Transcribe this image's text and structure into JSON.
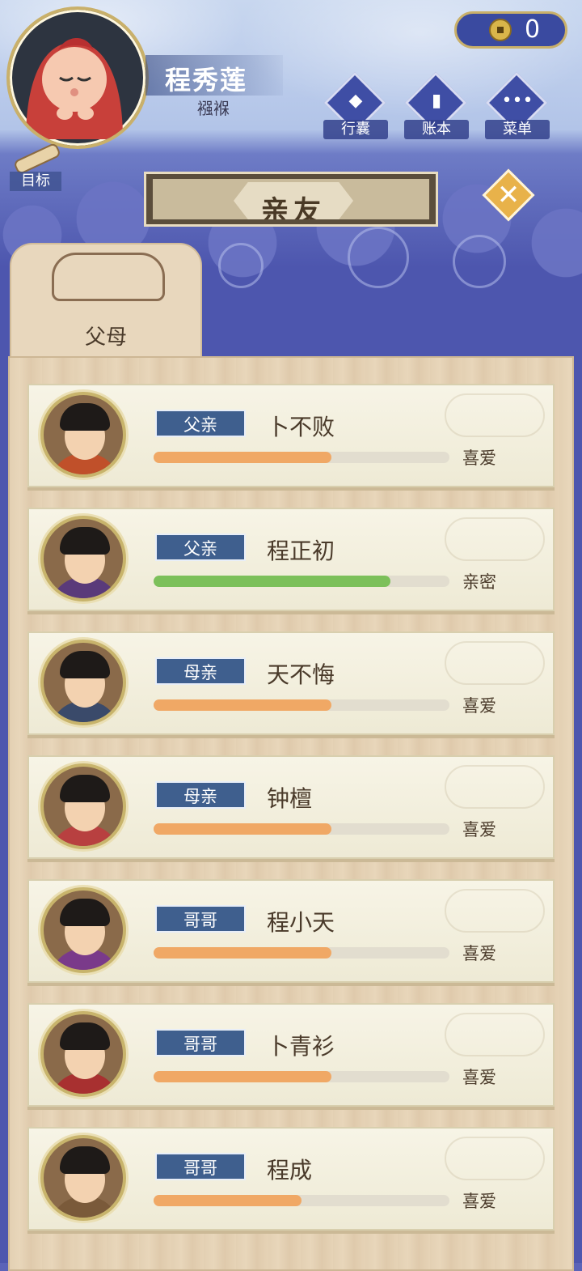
{
  "player": {
    "name": "程秀莲",
    "age_stage": "襁褓"
  },
  "goal": {
    "label": "目标"
  },
  "currency": {
    "amount": "0",
    "icon": "copper-coin-icon"
  },
  "top_buttons": [
    {
      "id": "bag",
      "label": "行囊",
      "icon": "bag-icon"
    },
    {
      "id": "ledger",
      "label": "账本",
      "icon": "ledger-icon"
    },
    {
      "id": "menu",
      "label": "菜单",
      "icon": "more-icon"
    }
  ],
  "title": "亲友",
  "tabs": [
    {
      "label": "父母",
      "active": true
    }
  ],
  "relatives": [
    {
      "relation": "父亲",
      "name": "卜不败",
      "status": "喜爱",
      "affinity": 0.6,
      "bar_color": "#f0a865",
      "robe_color": "#c0502a"
    },
    {
      "relation": "父亲",
      "name": "程正初",
      "status": "亲密",
      "affinity": 0.8,
      "bar_color": "#7cc05a",
      "robe_color": "#5a3a7a"
    },
    {
      "relation": "母亲",
      "name": "天不悔",
      "status": "喜爱",
      "affinity": 0.6,
      "bar_color": "#f0a865",
      "robe_color": "#3a4a6a"
    },
    {
      "relation": "母亲",
      "name": "钟檀",
      "status": "喜爱",
      "affinity": 0.6,
      "bar_color": "#f0a865",
      "robe_color": "#b84040"
    },
    {
      "relation": "哥哥",
      "name": "程小天",
      "status": "喜爱",
      "affinity": 0.6,
      "bar_color": "#f0a865",
      "robe_color": "#7a3a8a"
    },
    {
      "relation": "哥哥",
      "name": "卜青衫",
      "status": "喜爱",
      "affinity": 0.6,
      "bar_color": "#f0a865",
      "robe_color": "#a83030"
    },
    {
      "relation": "哥哥",
      "name": "程成",
      "status": "喜爱",
      "affinity": 0.5,
      "bar_color": "#f0a865",
      "robe_color": "#7a5a3a"
    }
  ]
}
